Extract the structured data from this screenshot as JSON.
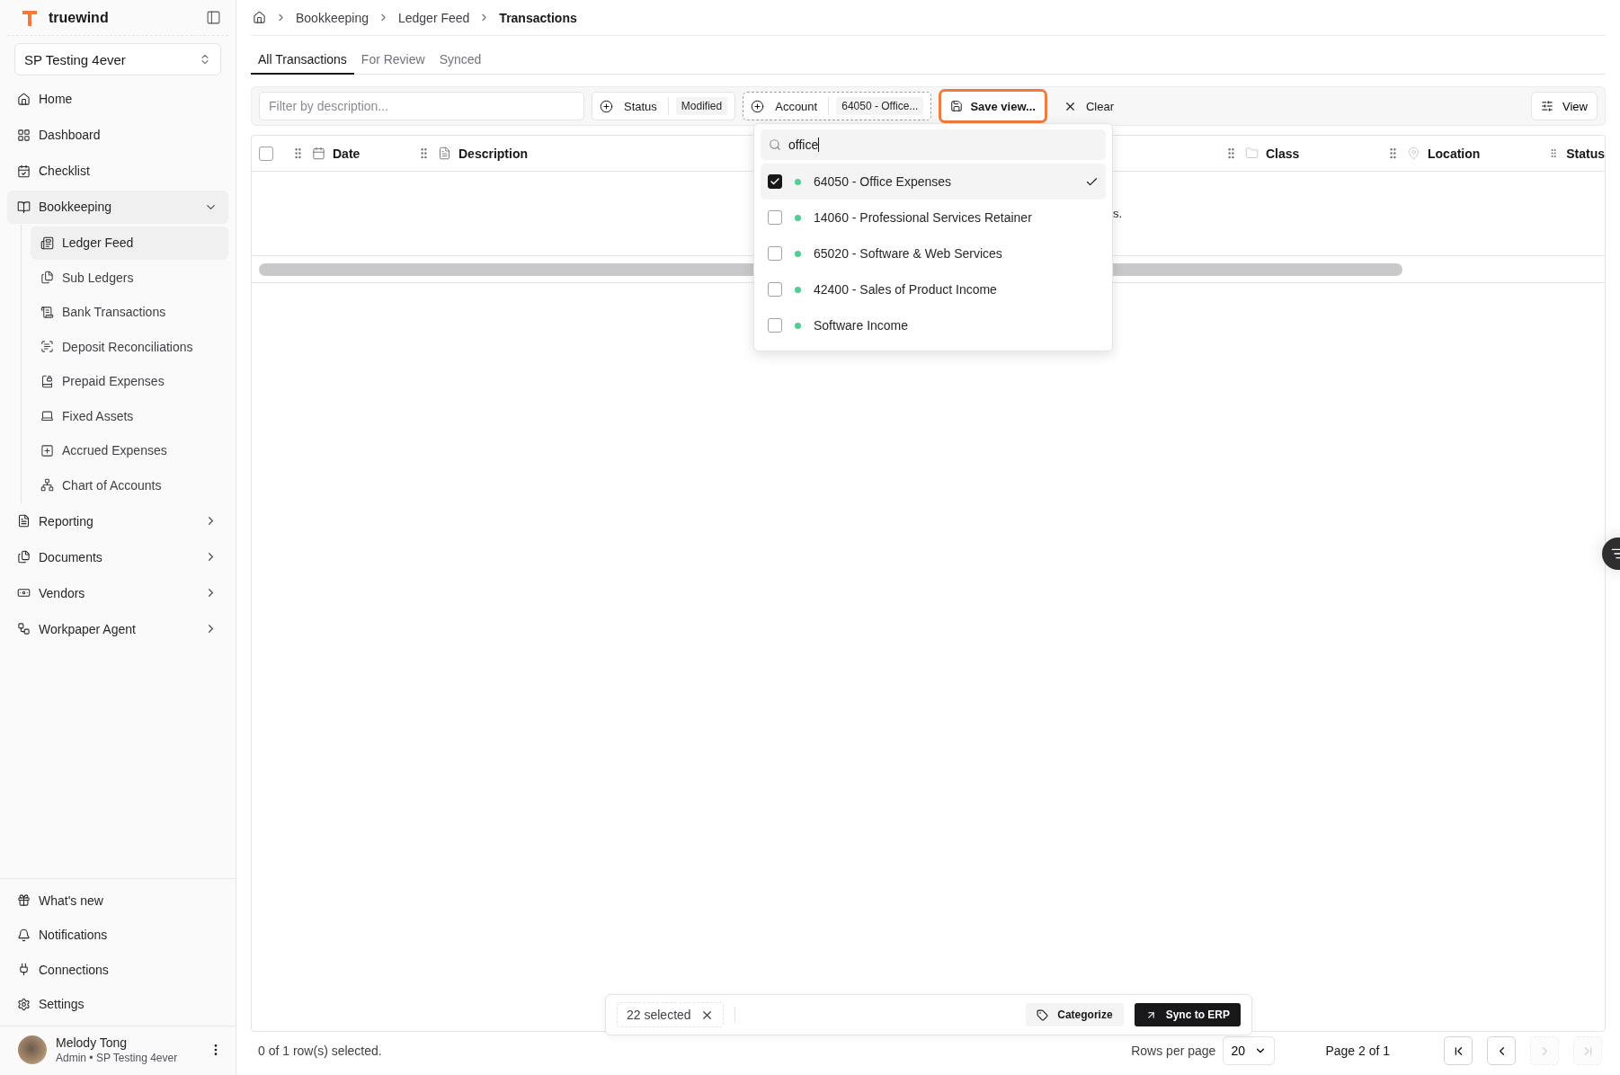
{
  "brand": {
    "name": "truewind"
  },
  "workspace": {
    "name": "SP Testing 4ever"
  },
  "nav": [
    {
      "label": "Home"
    },
    {
      "label": "Dashboard"
    },
    {
      "label": "Checklist"
    },
    {
      "label": "Bookkeeping",
      "expanded": true,
      "children": [
        {
          "label": "Ledger Feed",
          "selected": true
        },
        {
          "label": "Sub Ledgers",
          "selected": false
        },
        {
          "label": "Bank Transactions",
          "selected": false
        },
        {
          "label": "Deposit Reconciliations",
          "selected": false
        },
        {
          "label": "Prepaid Expenses",
          "selected": false
        },
        {
          "label": "Fixed Assets",
          "selected": false
        },
        {
          "label": "Accrued Expenses",
          "selected": false
        },
        {
          "label": "Chart of Accounts",
          "selected": false
        }
      ]
    },
    {
      "label": "Reporting",
      "expanded": false
    },
    {
      "label": "Documents",
      "expanded": false
    },
    {
      "label": "Vendors",
      "expanded": false
    },
    {
      "label": "Workpaper Agent",
      "expanded": false
    }
  ],
  "footer_nav": [
    "What's new",
    "Notifications",
    "Connections",
    "Settings"
  ],
  "user": {
    "name": "Melody Tong",
    "role": "Admin • SP Testing 4ever"
  },
  "breadcrumb": [
    "Bookkeeping",
    "Ledger Feed",
    "Transactions"
  ],
  "tabs": [
    {
      "label": "All Transactions",
      "selected": true
    },
    {
      "label": "For Review",
      "selected": false
    },
    {
      "label": "Synced",
      "selected": false
    }
  ],
  "toolbar": {
    "filter_placeholder": "Filter by description...",
    "filters": [
      {
        "label": "Status",
        "value": "Modified"
      },
      {
        "label": "Account",
        "value": "64050 - Office..."
      }
    ],
    "save_view": {
      "label": "Save view...",
      "highlighted": true
    },
    "clear": "Clear",
    "view": "View"
  },
  "table": {
    "select_all": {
      "checked": false
    },
    "columns": [
      {
        "label": "Date"
      },
      {
        "label": "Description"
      },
      {
        "label": "Class"
      },
      {
        "label": "Location"
      },
      {
        "label": "Status"
      }
    ],
    "empty_message": "s."
  },
  "account_dropdown": {
    "search": "office",
    "options": [
      {
        "label": "64050 - Office Expenses",
        "checked": true
      },
      {
        "label": "14060 - Professional Services Retainer",
        "checked": false
      },
      {
        "label": "65020 - Software & Web Services",
        "checked": false
      },
      {
        "label": "42400 - Sales of Product Income",
        "checked": false
      },
      {
        "label": "Software Income",
        "checked": false
      }
    ]
  },
  "footer": {
    "selection": "0 of 1 row(s) selected.",
    "rows_per_page": "Rows per page",
    "page_size": "20",
    "page": "Page 2 of 1",
    "pager": [
      {
        "kind": "first",
        "disabled": false
      },
      {
        "kind": "prev",
        "disabled": false
      },
      {
        "kind": "next",
        "disabled": true
      },
      {
        "kind": "last",
        "disabled": true
      }
    ]
  },
  "bulk_bar": {
    "count": "22 selected",
    "actions": [
      {
        "label": "Categorize",
        "kind": "secondary"
      },
      {
        "label": "Sync to ERP",
        "kind": "primary"
      }
    ]
  }
}
